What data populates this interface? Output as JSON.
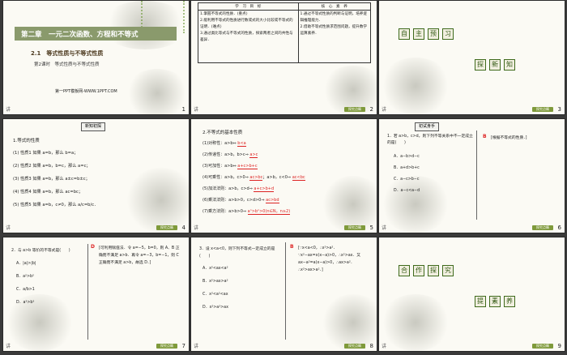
{
  "slides": [
    {
      "num": "1",
      "corner": "讲",
      "chapter": "第二章　一元二次函数、方程和不等式",
      "section": "2.1　等式性质与不等式性质",
      "lesson": "第2课时　等式性质与不等式性质",
      "footer": "第一PPT模板网-WWW.1PPT.COM"
    },
    {
      "num": "2",
      "corner": "讲",
      "h1": "学　习　目　标",
      "h2": "核　心　素　养",
      "l1": "1.掌握不等式的性质．(重点)",
      "l2": "2.能利用不等式的性质进行数或式的大小比较或不等式的证明．(难点)",
      "l3": "3.通过类比等式与不等式的性质，探索两者之间的共性与差异．",
      "r1": "1.通过不等式性质的判断与证明，培养逻辑推理能力．",
      "r2": "2.借助不等式性质求范围问题，提升数学运算素养．",
      "foot": "探究点睛"
    },
    {
      "num": "3",
      "corner": "讲",
      "s1": "自",
      "s2": "主",
      "s3": "预",
      "s4": "习",
      "s5": "探",
      "s6": "新",
      "s7": "知",
      "foot": "探究点睛"
    },
    {
      "num": "4",
      "corner": "讲",
      "tag": "新知初探",
      "title": "1.等式的性质",
      "p1": "(1) 性质1 如果 a=b，那么 b=a；",
      "p2": "(2) 性质2 如果 a=b，b=c，那么 a=c；",
      "p3": "(3) 性质3 如果 a=b，那么 a±c=b±c；",
      "p4": "(4) 性质4 如果 a=b，那么 ac=bc；",
      "p5": "(5) 性质5 如果 a=b，c≠0，那么 a/c=b/c．",
      "foot": "探究点睛"
    },
    {
      "num": "5",
      "corner": "讲",
      "title": "2.不等式的基本性质",
      "p1": "(1)对称性：a>b⇔",
      "a1": "b<a",
      "p2": "(2)传递性：a>b，b>c⇒",
      "a2": "a>c",
      "p3": "(3)可加性：a>b⇔",
      "a3": "a+c>b+c",
      "p4": "(4)可乘性：a>b，c>0⇒",
      "a4": "ac>bc",
      "p4b": "；a>b，c<0⇒",
      "a4b": "ac<bc",
      "p5": "(5)加法法则：a>b，c>d⇒",
      "a5": "a+c>b+d",
      "p6": "(6)乘法法则：a>b>0，c>d>0⇒",
      "a6": "ac>bd",
      "p7": "(7)乘方法则：a>b>0⇒",
      "a7": "aⁿ>bⁿ>0(n∈N，n≥2)",
      "foot": "探究点睛"
    },
    {
      "num": "6",
      "corner": "讲",
      "tag": "初试身手",
      "q": "1．若 a>b，c>d，则下列不等关系中不一定成立的是(　　)",
      "o1": "A．a−b>d−c",
      "o2": "B．a+d>b+c",
      "o3": "C．a−c>b−c",
      "o4": "D．a−c<a−d",
      "ans": "B",
      "expl": "[根据不等式的性质．]",
      "foot": "探究点睛"
    },
    {
      "num": "7",
      "corner": "讲",
      "q": "2．与 a>b 等价的不等式是(　　)",
      "o1": "A．|a|>|b|",
      "o2": "B．a²>b²",
      "o3": "C．a/b>1",
      "o4": "D．a³>b³",
      "ans": "D",
      "expl": "[可利用赋值法．令 a=−5，b=0，则 A、B 正确而不满足 a>b．再令 a=−3，b=−1，则 C 正确而不满足 a>b，故选 D．]",
      "foot": "探究点睛"
    },
    {
      "num": "8",
      "corner": "讲",
      "q": "3．设 x<a<0，则下列不等式一定成立的是(　　)",
      "o1": "A．x²<ax<a²",
      "o2": "B．x²>ax>a²",
      "o3": "C．x²<a²<ax",
      "o4": "D．x²>a²>ax",
      "ans": "B",
      "expl": "[∵x<a<0，∴x²>a²．∵x²−ax=x(x−a)>0，∴x²>ax．又 ax−a²=a(x−a)>0，∴ax>a²．∴x²>ax>a²．]",
      "foot": "探究点睛"
    },
    {
      "num": "9",
      "corner": "讲",
      "s1": "合",
      "s2": "作",
      "s3": "探",
      "s4": "究",
      "s5": "提",
      "s6": "素",
      "s7": "养",
      "foot": "探究点睛"
    }
  ],
  "colors": {
    "accent": "#7f9a3b",
    "red": "#d22222",
    "dark_green": "#335a14"
  }
}
